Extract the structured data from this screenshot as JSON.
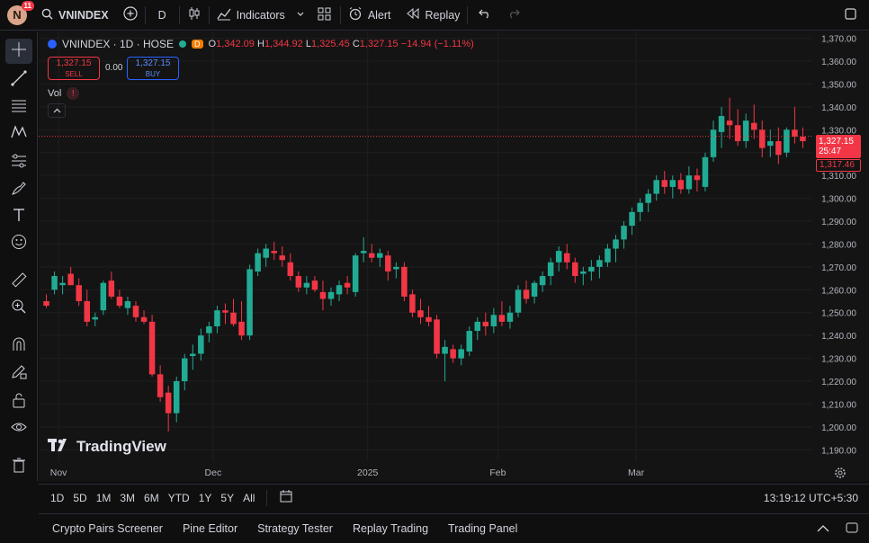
{
  "header": {
    "avatar_letter": "N",
    "notifications": "11",
    "symbol": "VNINDEX",
    "interval": "D",
    "indicators_label": "Indicators",
    "alert_label": "Alert",
    "replay_label": "Replay"
  },
  "legend": {
    "title": "VNINDEX · 1D · HOSE",
    "d_badge": "D",
    "o_label": "O",
    "o": "1,342.09",
    "h_label": "H",
    "h": "1,344.92",
    "l_label": "L",
    "l": "1,325.45",
    "c_label": "C",
    "c": "1,327.15",
    "change": "−14.94 (−1.11%)"
  },
  "trade": {
    "sell_price": "1,327.15",
    "sell_label": "SELL",
    "spread": "0.00",
    "buy_price": "1,327.15",
    "buy_label": "BUY"
  },
  "volume": {
    "label": "Vol",
    "warn": "!"
  },
  "branding": "TradingView",
  "price_tag": {
    "price": "1,327.15",
    "countdown": "25:47",
    "second": "1,317.46"
  },
  "range_buttons": [
    "1D",
    "5D",
    "1M",
    "3M",
    "6M",
    "YTD",
    "1Y",
    "5Y",
    "All"
  ],
  "clock": "13:19:12 UTC+5:30",
  "bottom_tabs": [
    "Crypto Pairs Screener",
    "Pine Editor",
    "Strategy Tester",
    "Replay Trading",
    "Trading Panel"
  ],
  "colors": {
    "up": "#22ab94",
    "down": "#f23645",
    "background": "#141414",
    "grid": "#1e1e1e"
  },
  "chart_data": {
    "type": "candlestick",
    "y_ticks": [
      "1,370.00",
      "1,360.00",
      "1,350.00",
      "1,340.00",
      "1,330.00",
      "1,320.00",
      "1,310.00",
      "1,300.00",
      "1,290.00",
      "1,280.00",
      "1,270.00",
      "1,260.00",
      "1,250.00",
      "1,240.00",
      "1,230.00",
      "1,220.00",
      "1,210.00",
      "1,200.00",
      "1,190.00"
    ],
    "ylim": [
      1185,
      1373
    ],
    "x_labels": [
      "Nov",
      "Dec",
      "2025",
      "Feb",
      "Mar"
    ],
    "last_price": 1327.15,
    "candles": [
      [
        1255,
        1258,
        1252,
        1253
      ],
      [
        1260,
        1268,
        1258,
        1266
      ],
      [
        1262,
        1266,
        1258,
        1263
      ],
      [
        1267,
        1270,
        1262,
        1262
      ],
      [
        1262,
        1265,
        1253,
        1255
      ],
      [
        1255,
        1260,
        1244,
        1246
      ],
      [
        1247,
        1250,
        1244,
        1248
      ],
      [
        1251,
        1264,
        1249,
        1263
      ],
      [
        1264,
        1268,
        1256,
        1257
      ],
      [
        1257,
        1260,
        1252,
        1253
      ],
      [
        1252,
        1257,
        1249,
        1255
      ],
      [
        1253,
        1255,
        1246,
        1248
      ],
      [
        1248,
        1251,
        1245,
        1246
      ],
      [
        1246,
        1249,
        1222,
        1223
      ],
      [
        1223,
        1227,
        1211,
        1213
      ],
      [
        1215,
        1218,
        1198,
        1206
      ],
      [
        1206,
        1222,
        1202,
        1220
      ],
      [
        1220,
        1232,
        1216,
        1230
      ],
      [
        1231,
        1236,
        1225,
        1232
      ],
      [
        1232,
        1243,
        1229,
        1240
      ],
      [
        1241,
        1246,
        1237,
        1244
      ],
      [
        1244,
        1253,
        1241,
        1251
      ],
      [
        1251,
        1254,
        1245,
        1250
      ],
      [
        1250,
        1256,
        1244,
        1245
      ],
      [
        1246,
        1255,
        1238,
        1240
      ],
      [
        1240,
        1271,
        1238,
        1269
      ],
      [
        1268,
        1278,
        1266,
        1276
      ],
      [
        1274,
        1280,
        1270,
        1278
      ],
      [
        1277,
        1281,
        1273,
        1276
      ],
      [
        1275,
        1279,
        1270,
        1273
      ],
      [
        1272,
        1276,
        1264,
        1266
      ],
      [
        1266,
        1268,
        1259,
        1261
      ],
      [
        1261,
        1266,
        1258,
        1263
      ],
      [
        1264,
        1266,
        1259,
        1260
      ],
      [
        1259,
        1264,
        1251,
        1256
      ],
      [
        1256,
        1261,
        1253,
        1259
      ],
      [
        1258,
        1264,
        1255,
        1262
      ],
      [
        1263,
        1266,
        1258,
        1261
      ],
      [
        1259,
        1276,
        1257,
        1275
      ],
      [
        1276,
        1283,
        1272,
        1277
      ],
      [
        1276,
        1280,
        1272,
        1274
      ],
      [
        1274,
        1278,
        1270,
        1276
      ],
      [
        1275,
        1277,
        1264,
        1268
      ],
      [
        1269,
        1272,
        1265,
        1270
      ],
      [
        1270,
        1272,
        1255,
        1257
      ],
      [
        1258,
        1260,
        1248,
        1250
      ],
      [
        1251,
        1256,
        1245,
        1248
      ],
      [
        1248,
        1253,
        1244,
        1246
      ],
      [
        1247,
        1249,
        1230,
        1232
      ],
      [
        1232,
        1238,
        1220,
        1235
      ],
      [
        1234,
        1236,
        1228,
        1230
      ],
      [
        1230,
        1236,
        1227,
        1234
      ],
      [
        1233,
        1244,
        1231,
        1242
      ],
      [
        1242,
        1248,
        1238,
        1246
      ],
      [
        1246,
        1250,
        1240,
        1244
      ],
      [
        1244,
        1252,
        1241,
        1249
      ],
      [
        1249,
        1255,
        1244,
        1246
      ],
      [
        1246,
        1253,
        1243,
        1250
      ],
      [
        1250,
        1262,
        1248,
        1260
      ],
      [
        1260,
        1264,
        1254,
        1256
      ],
      [
        1257,
        1264,
        1254,
        1263
      ],
      [
        1262,
        1268,
        1259,
        1266
      ],
      [
        1266,
        1274,
        1262,
        1272
      ],
      [
        1272,
        1279,
        1268,
        1277
      ],
      [
        1276,
        1280,
        1269,
        1272
      ],
      [
        1272,
        1274,
        1263,
        1266
      ],
      [
        1267,
        1270,
        1262,
        1268
      ],
      [
        1268,
        1273,
        1264,
        1270
      ],
      [
        1270,
        1275,
        1265,
        1273
      ],
      [
        1272,
        1280,
        1270,
        1278
      ],
      [
        1278,
        1284,
        1272,
        1282
      ],
      [
        1282,
        1290,
        1278,
        1288
      ],
      [
        1288,
        1296,
        1284,
        1294
      ],
      [
        1294,
        1300,
        1290,
        1298
      ],
      [
        1298,
        1304,
        1294,
        1302
      ],
      [
        1302,
        1310,
        1299,
        1308
      ],
      [
        1308,
        1312,
        1302,
        1305
      ],
      [
        1305,
        1310,
        1300,
        1308
      ],
      [
        1308,
        1311,
        1302,
        1304
      ],
      [
        1304,
        1314,
        1302,
        1310
      ],
      [
        1310,
        1313,
        1303,
        1308
      ],
      [
        1305,
        1320,
        1303,
        1318
      ],
      [
        1318,
        1334,
        1316,
        1330
      ],
      [
        1329,
        1340,
        1322,
        1336
      ],
      [
        1334,
        1344,
        1326,
        1332
      ],
      [
        1332,
        1339,
        1323,
        1325
      ],
      [
        1325,
        1337,
        1322,
        1334
      ],
      [
        1333,
        1341,
        1326,
        1330
      ],
      [
        1330,
        1334,
        1318,
        1322
      ],
      [
        1323,
        1330,
        1318,
        1325
      ],
      [
        1325,
        1331,
        1315,
        1319
      ],
      [
        1320,
        1331,
        1318,
        1330
      ],
      [
        1330,
        1340,
        1324,
        1327
      ],
      [
        1327,
        1331,
        1322,
        1325
      ]
    ]
  }
}
